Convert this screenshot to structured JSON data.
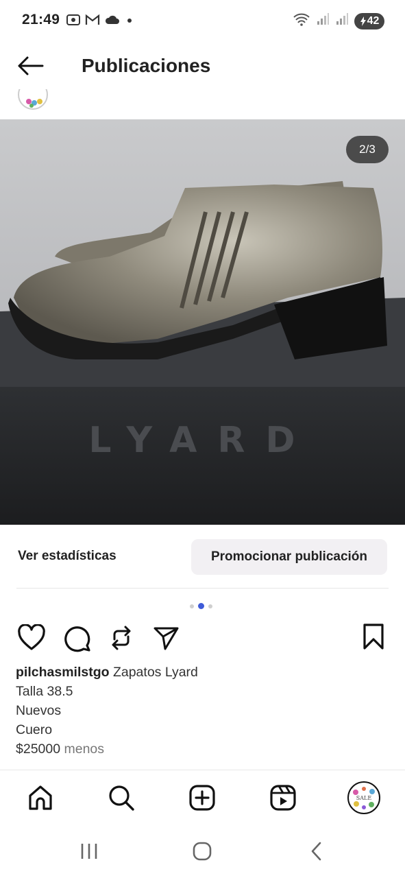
{
  "status_bar": {
    "time": "21:49",
    "battery": "42",
    "icons": [
      "screenshot-icon",
      "gmail-icon",
      "cloud-icon",
      "dot-icon",
      "wifi-icon",
      "signal-icon",
      "signal-icon-2",
      "battery-icon"
    ]
  },
  "header": {
    "title": "Publicaciones",
    "back_icon": "arrow-left-icon"
  },
  "post": {
    "image_counter": "2/3",
    "image_brand_text": "LYARD",
    "carousel": {
      "count": 3,
      "active_index": 1
    },
    "stats_label": "Ver estadísticas",
    "promote_label": "Promocionar publicación",
    "actions": [
      "heart-icon",
      "comment-icon",
      "repost-icon",
      "send-icon",
      "bookmark-icon"
    ],
    "caption": {
      "username": "pilchasmilstgo",
      "first_line": "Zapatos Lyard",
      "lines": [
        "Talla 38.5",
        "Nuevos",
        "Cuero"
      ],
      "price": "$25000",
      "more": "menos"
    }
  },
  "bottom_nav": {
    "items": [
      "home-icon",
      "search-icon",
      "create-icon",
      "reels-icon",
      "profile-avatar"
    ],
    "profile_badge_text": "SALE"
  },
  "system_nav": [
    "recents-icon",
    "home-circle-icon",
    "back-chevron-icon"
  ],
  "colors": {
    "accent": "#3f5bd8",
    "promote_bg": "#f2f0f3",
    "text": "#222222"
  }
}
